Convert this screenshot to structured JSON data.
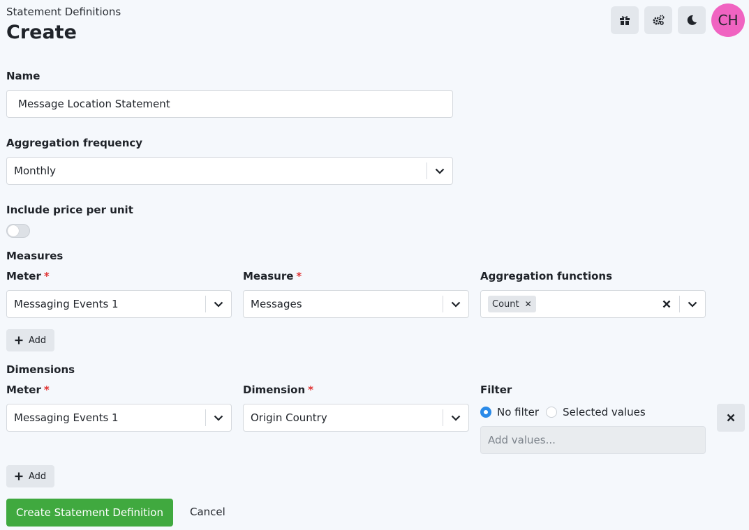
{
  "header": {
    "breadcrumb": "Statement Definitions",
    "title": "Create",
    "icons": [
      "gift-icon",
      "settings-icon",
      "moon-icon"
    ],
    "avatar_initials": "CH",
    "avatar_color": "#f063c1"
  },
  "form": {
    "name_label": "Name",
    "name_value": "Message Location Statement",
    "frequency_label": "Aggregation frequency",
    "frequency_value": "Monthly",
    "price_label": "Include price per unit",
    "price_enabled": false
  },
  "measures": {
    "title": "Measures",
    "meter_label": "Meter",
    "meter_value": "Messaging Events 1",
    "measure_label": "Measure",
    "measure_value": "Messages",
    "agg_label": "Aggregation functions",
    "agg_chips": [
      "Count"
    ],
    "add_label": "Add"
  },
  "dimensions": {
    "title": "Dimensions",
    "meter_label": "Meter",
    "meter_value": "Messaging Events 1",
    "dimension_label": "Dimension",
    "dimension_value": "Origin Country",
    "filter_label": "Filter",
    "filter_options": [
      "No filter",
      "Selected values"
    ],
    "filter_selected": "No filter",
    "values_placeholder": "Add values...",
    "add_label": "Add"
  },
  "required_mark": "*",
  "actions": {
    "submit_label": "Create Statement Definition",
    "cancel_label": "Cancel"
  },
  "colors": {
    "background": "#f5f8fc",
    "primary": "#40a93f",
    "radio_selected": "#2a8ae8",
    "required": "#e03131"
  }
}
